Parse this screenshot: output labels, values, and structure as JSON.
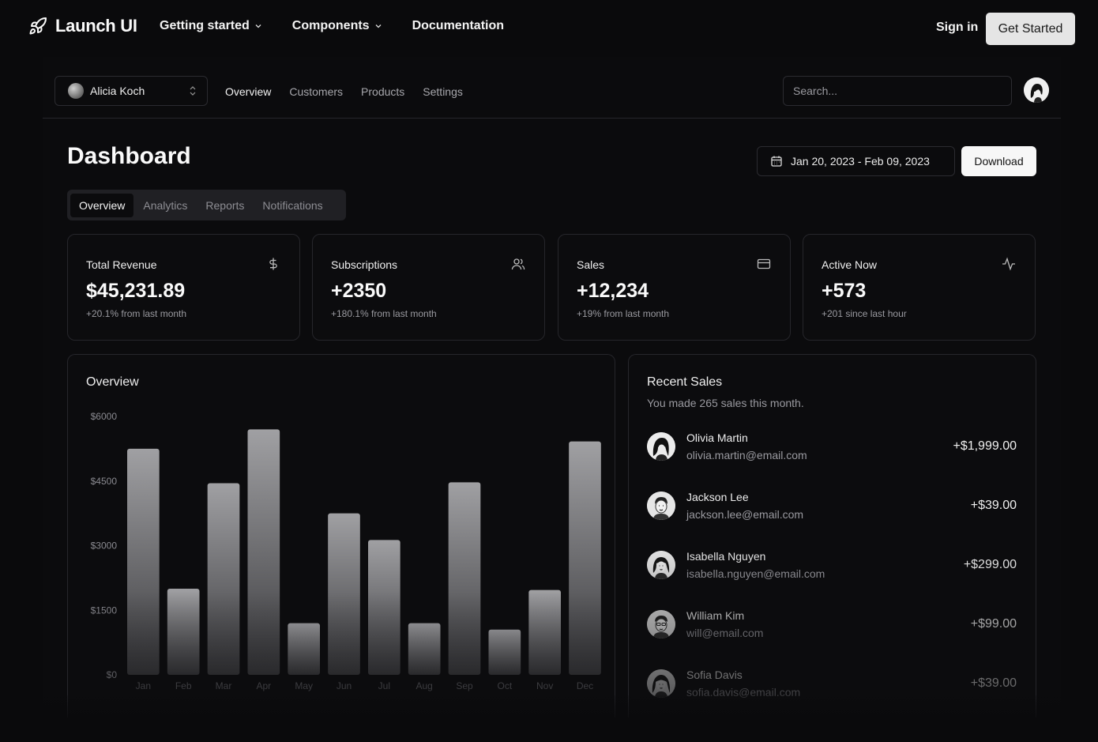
{
  "topnav": {
    "brand": "Launch UI",
    "links": [
      {
        "label": "Getting started",
        "dropdown": true
      },
      {
        "label": "Components",
        "dropdown": true
      },
      {
        "label": "Documentation",
        "dropdown": false
      }
    ],
    "signin": "Sign in",
    "cta": "Get Started"
  },
  "subnav": {
    "team": "Alicia Koch",
    "links": [
      "Overview",
      "Customers",
      "Products",
      "Settings"
    ],
    "active_link": "Overview",
    "search_placeholder": "Search..."
  },
  "header": {
    "title": "Dashboard",
    "date_range": "Jan 20, 2023 - Feb 09, 2023",
    "download": "Download",
    "tabs": [
      "Overview",
      "Analytics",
      "Reports",
      "Notifications"
    ],
    "active_tab": "Overview"
  },
  "cards": [
    {
      "title": "Total Revenue",
      "value": "$45,231.89",
      "sub": "+20.1% from last month",
      "icon": "dollar-icon"
    },
    {
      "title": "Subscriptions",
      "value": "+2350",
      "sub": "+180.1% from last month",
      "icon": "users-icon"
    },
    {
      "title": "Sales",
      "value": "+12,234",
      "sub": "+19% from last month",
      "icon": "credit-card-icon"
    },
    {
      "title": "Active Now",
      "value": "+573",
      "sub": "+201 since last hour",
      "icon": "activity-icon"
    }
  ],
  "overview": {
    "title": "Overview"
  },
  "chart_data": {
    "type": "bar",
    "title": "Overview",
    "categories": [
      "Jan",
      "Feb",
      "Mar",
      "Apr",
      "May",
      "Jun",
      "Jul",
      "Aug",
      "Sep",
      "Oct",
      "Nov",
      "Dec"
    ],
    "values": [
      5250,
      2000,
      4450,
      5700,
      1200,
      3750,
      3130,
      1200,
      4470,
      1050,
      1970,
      5420
    ],
    "yticks": [
      "$6000",
      "$4500",
      "$3000",
      "$1500",
      "$0"
    ],
    "ylim": [
      0,
      6000
    ],
    "grid": false,
    "colors": {
      "bar_top": "#a0a0a3",
      "bar_bottom": "#3a3a3d"
    }
  },
  "recent_sales": {
    "title": "Recent Sales",
    "subtitle": "You made 265 sales this month.",
    "rows": [
      {
        "name": "Olivia Martin",
        "email": "olivia.martin@email.com",
        "amount": "+$1,999.00"
      },
      {
        "name": "Jackson Lee",
        "email": "jackson.lee@email.com",
        "amount": "+$39.00"
      },
      {
        "name": "Isabella Nguyen",
        "email": "isabella.nguyen@email.com",
        "amount": "+$299.00"
      },
      {
        "name": "William Kim",
        "email": "will@email.com",
        "amount": "+$99.00"
      },
      {
        "name": "Sofia Davis",
        "email": "sofia.davis@email.com",
        "amount": "+$39.00"
      }
    ]
  }
}
